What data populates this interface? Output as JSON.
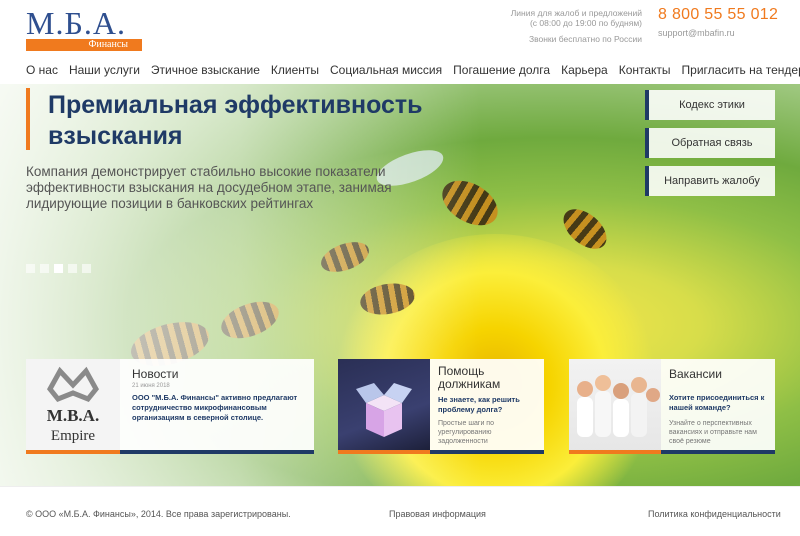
{
  "header": {
    "logo_text": "М.Б.А.",
    "logo_sub": "Финансы",
    "hotline_line1": "Линия для жалоб и предложений",
    "hotline_line2": "(с 08:00 до 19:00 по будням)",
    "hotline_line3": "Звонки бесплатно по России",
    "phone": "8 800 55 55 012",
    "email": "support@mbafin.ru"
  },
  "nav": {
    "items": [
      "О нас",
      "Наши услуги",
      "Этичное взыскание",
      "Клиенты",
      "Социальная миссия",
      "Погашение долга",
      "Карьера",
      "Контакты",
      "Пригласить на тендер"
    ]
  },
  "hero": {
    "title": "Премиальная эффективность взыскания",
    "subtitle": "Компания демонстрирует стабильно высокие показатели эффективности взыскания на досудебном этапе, занимая лидирующие позиции в банковских рейтингах",
    "active_slide": 4,
    "slide_count": 5
  },
  "side_buttons": [
    "Кодекс этики",
    "Обратная связь",
    "Направить жалобу"
  ],
  "cards": {
    "news": {
      "title": "Новости",
      "date": "21 июня 2018",
      "text": "ООО \"М.Б.А. Финансы\" активно предлагают сотрудничество микрофинансовым организациям в северной столице.",
      "logo_line1": "M.B.A.",
      "logo_line2": "Empire"
    },
    "help": {
      "title": "Помощь должникам",
      "bold": "Не знаете, как решить проблему долга?",
      "text": "Простые шаги по урегулированию задолженности"
    },
    "jobs": {
      "title": "Вакансии",
      "bold": "Хотите присоединиться к нашей команде?",
      "text": "Узнайте о перспективных вакансиях и отправьте нам своё резюме"
    }
  },
  "footer": {
    "copyright": "© ООО «М.Б.А. Финансы», 2014. Все права зарегистрированы.",
    "legal": "Правовая информация",
    "privacy": "Политика конфиденциальности"
  },
  "colors": {
    "accent": "#f07a1e",
    "brand": "#1f3a66"
  }
}
